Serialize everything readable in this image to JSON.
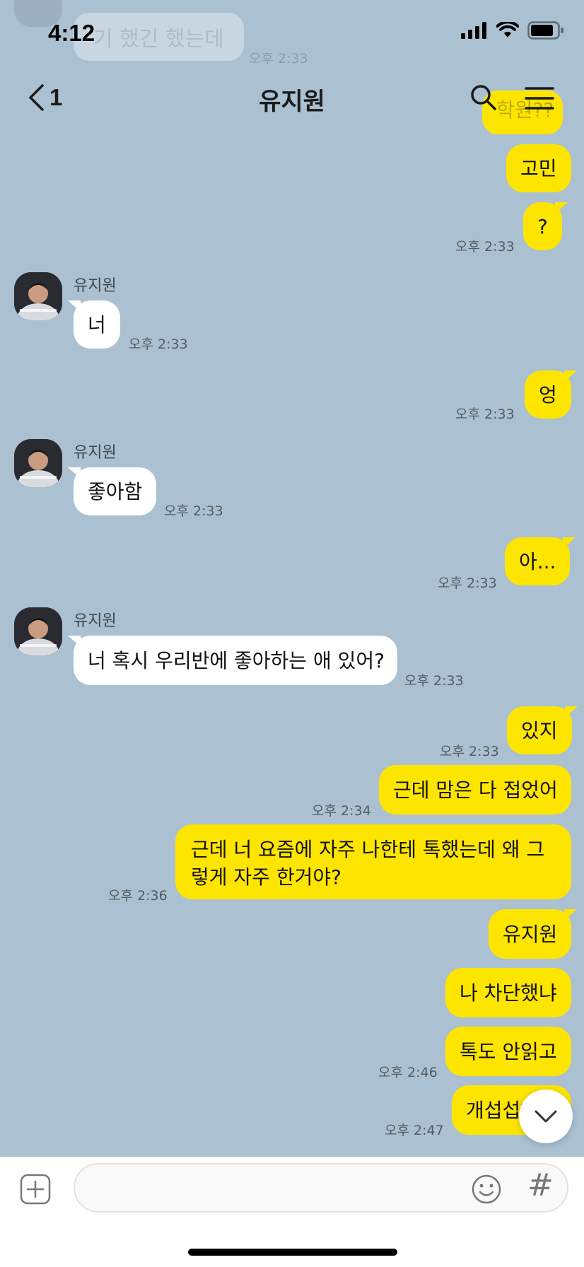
{
  "status_bar": {
    "time": "4:12"
  },
  "header": {
    "back_count": "1",
    "title": "유지원"
  },
  "ghost": {
    "top_left_text": "기 했긴 했는데",
    "top_left_time": "오후 2:33",
    "top_right_text": "학원??"
  },
  "messages": [
    {
      "from": "me",
      "text": "고민",
      "time": ""
    },
    {
      "from": "me",
      "text": "?",
      "time": "오후 2:33"
    },
    {
      "from": "other",
      "sender": "유지원",
      "text": "너",
      "time": "오후 2:33"
    },
    {
      "from": "me",
      "text": "엉",
      "time": "오후 2:33"
    },
    {
      "from": "other",
      "sender": "유지원",
      "text": "좋아함",
      "time": "오후 2:33"
    },
    {
      "from": "me",
      "text": "아...",
      "time": "오후 2:33"
    },
    {
      "from": "other",
      "sender": "유지원",
      "text": "너 혹시 우리반에 좋아하는 애 있어?",
      "time": "오후 2:33"
    },
    {
      "from": "me",
      "text": "있지",
      "time": "오후 2:33"
    },
    {
      "from": "me",
      "text": "근데 맘은 다 접었어",
      "time": "오후 2:34"
    },
    {
      "from": "me",
      "text": "근데 너 요즘에 자주 나한테 톡했는데 왜 그렇게 자주 한거야?",
      "time": "오후 2:36"
    },
    {
      "from": "me",
      "text": "유지원",
      "time": ""
    },
    {
      "from": "me",
      "text": "나 차단했냐",
      "time": ""
    },
    {
      "from": "me",
      "text": "톡도 안읽고",
      "time": "오후 2:46"
    },
    {
      "from": "me",
      "text": "개섭섭하네",
      "time": "오후 2:47"
    }
  ],
  "input": {
    "placeholder": ""
  },
  "icons": {
    "back": "chevron-left-icon",
    "search": "search-icon",
    "menu": "menu-icon",
    "plus": "plus-icon",
    "emoji": "emoji-icon",
    "hash": "hash-icon",
    "scroll_down": "chevron-down-icon"
  },
  "labels": {
    "hash": "#"
  },
  "colors": {
    "background": "#abc1d1",
    "my_bubble": "#fee500",
    "other_bubble": "#ffffff"
  }
}
